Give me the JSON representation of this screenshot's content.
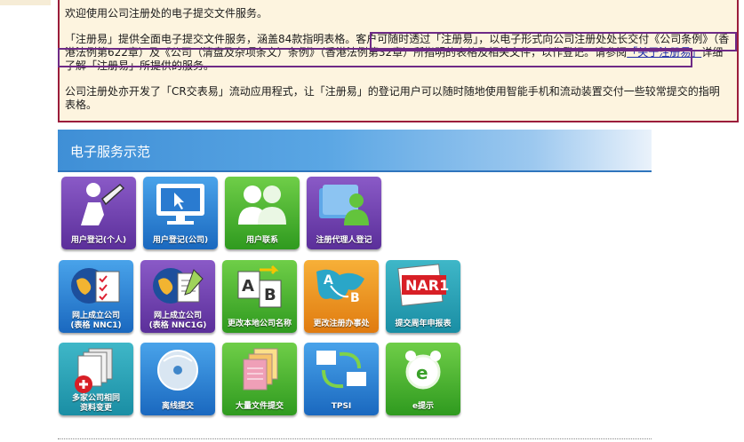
{
  "notice": {
    "line1": "欢迎使用公司注册处的电子提交文件服务。",
    "para2_a": "「注册易」提供全面电子提交文件服务，涵盖84款指明表格。客户可随时透过「注册易」，以电子形式向公司注册处处长交付《公司条例》（香港法例第622章）及《公司（清盘及杂项条文）条例》（香港法例第32章）所指明的表格及相关文件，以作登记。请参阅",
    "para2_link": "「关于注册易」",
    "para2_b": "详细了解「注册易」所提供的服务。",
    "para3": "公司注册处亦开发了「CR交表易」流动应用程式，让「注册易」的登记用户可以随时随地使用智能手机和流动装置交付一些较常提交的指明表格。"
  },
  "banner": {
    "title": "电子服务示范"
  },
  "tiles": [
    {
      "label": "用户登记(个人)",
      "icon": "pen-person-icon",
      "color": "purple"
    },
    {
      "label": "用户登记(公司)",
      "icon": "monitor-icon",
      "color": "blue"
    },
    {
      "label": "用户联系",
      "icon": "users-icon",
      "color": "green"
    },
    {
      "label": "注册代理人登记",
      "icon": "folder-user-icon",
      "color": "purple"
    },
    {
      "label": "网上成立公司\n(表格 NNC1)",
      "icon": "globe-form-icon",
      "color": "blue"
    },
    {
      "label": "网上成立公司\n(表格 NNC1G)",
      "icon": "globe-form-pen-icon",
      "color": "purple"
    },
    {
      "label": "更改本地公司名称",
      "icon": "ab-rename-icon",
      "color": "green"
    },
    {
      "label": "更改注册办事处",
      "icon": "map-ab-icon",
      "color": "orange"
    },
    {
      "label": "提交周年申报表",
      "icon": "nar1-icon",
      "color": "teal"
    },
    {
      "label": "多家公司相同\n资料变更",
      "icon": "documents-plus-icon",
      "color": "teal"
    },
    {
      "label": "离线提交",
      "icon": "disc-icon",
      "color": "blue"
    },
    {
      "label": "大量文件提交",
      "icon": "stack-files-icon",
      "color": "green"
    },
    {
      "label": "TPSI",
      "icon": "computers-sync-icon",
      "color": "blue"
    },
    {
      "label": "e提示",
      "icon": "alarm-clock-icon",
      "color": "green"
    }
  ]
}
